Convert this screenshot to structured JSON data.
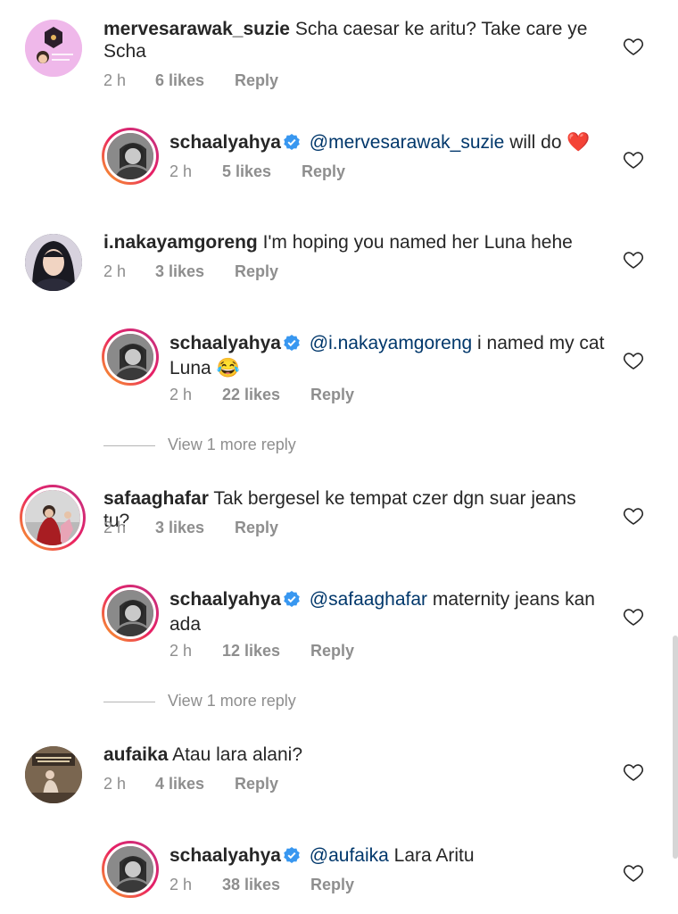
{
  "comments": [
    {
      "user": "mervesarawak_suzie",
      "text": "Scha caesar ke aritu? Take care ye Scha",
      "time": "2 h",
      "likes": "6 likes",
      "reply": "Reply"
    },
    {
      "user": "schaalyahya",
      "mention": "@mervesarawak_suzie",
      "text": "will do",
      "emoji": "❤️",
      "time": "2 h",
      "likes": "5 likes",
      "reply": "Reply"
    },
    {
      "user": "i.nakayamgoreng",
      "text": "I'm hoping you named her Luna hehe",
      "time": "2 h",
      "likes": "3 likes",
      "reply": "Reply"
    },
    {
      "user": "schaalyahya",
      "mention": "@i.nakayamgoreng",
      "text": "i named my cat Luna",
      "emoji": "😂",
      "time": "2 h",
      "likes": "22 likes",
      "reply": "Reply"
    },
    {
      "user": "safaaghafar",
      "text": "Tak bergesel ke tempat czer dgn suar jeans tu?",
      "time": "2 h",
      "likes": "3 likes",
      "reply": "Reply"
    },
    {
      "user": "schaalyahya",
      "mention": "@safaaghafar",
      "text": "maternity jeans kan ada",
      "time": "2 h",
      "likes": "12 likes",
      "reply": "Reply"
    },
    {
      "user": "aufaika",
      "text": "Atau lara alani?",
      "time": "2 h",
      "likes": "4 likes",
      "reply": "Reply"
    },
    {
      "user": "schaalyahya",
      "mention": "@aufaika",
      "text": "Lara Aritu",
      "time": "2 h",
      "likes": "38 likes",
      "reply": "Reply"
    }
  ],
  "view_more": [
    "View 1 more reply",
    "View 1 more reply"
  ],
  "colors": {
    "text": "#262626",
    "secondary": "#8e8e8e",
    "mention": "#00376b",
    "verified": "#3897f0"
  }
}
